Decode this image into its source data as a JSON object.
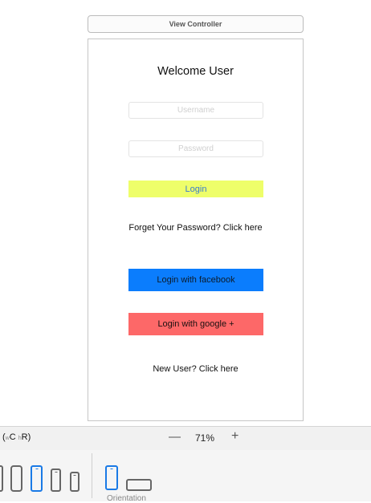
{
  "scene": {
    "header_title": "View Controller"
  },
  "screen": {
    "welcome_title": "Welcome User",
    "username_placeholder": "Username",
    "password_placeholder": "Password",
    "login_label": "Login",
    "forgot_text": "Forget Your Password? Click here",
    "facebook_label": "Login with facebook",
    "google_label": "Login with google +",
    "new_user_text": "New User? Click here"
  },
  "colors": {
    "login_button": "#eefe6a",
    "facebook_button": "#0b7dfd",
    "google_button": "#fd6868",
    "selected_device": "#1a7ae6"
  },
  "statusbar": {
    "size_class_open": "(",
    "size_class_w": "w",
    "size_class_w_value": "C",
    "size_class_h": "h",
    "size_class_h_value": "R",
    "size_class_close": ")",
    "zoom_out_symbol": "—",
    "zoom_level": "71%",
    "zoom_in_symbol": "+"
  },
  "devicebar": {
    "devices": [
      "ipad-icon",
      "iphone-plus-icon",
      "iphone-icon",
      "iphone-se-icon",
      "iphone-4-icon"
    ],
    "selected_device": "iphone-icon",
    "orientations": [
      "portrait-icon",
      "landscape-icon"
    ],
    "selected_orientation": "portrait-icon",
    "orientation_label": "Orientation"
  }
}
